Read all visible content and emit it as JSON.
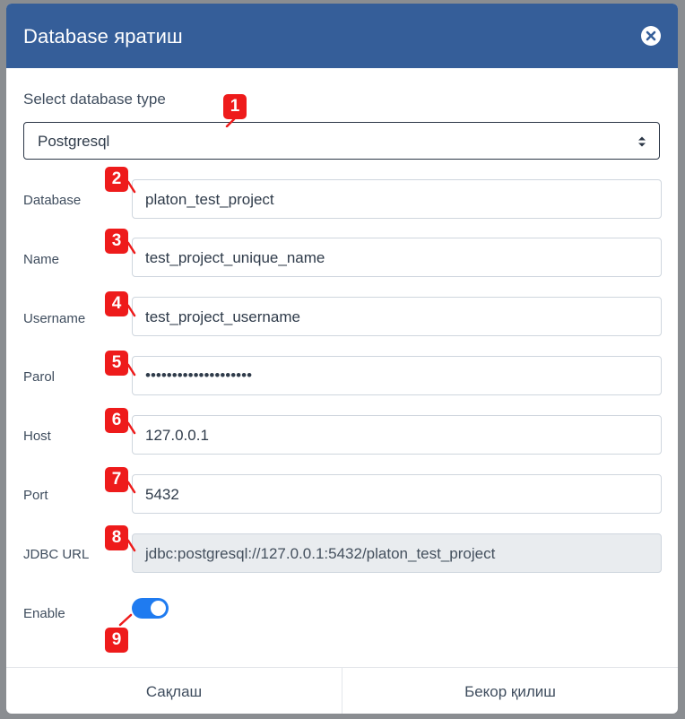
{
  "dialog": {
    "title": "Database яратиш"
  },
  "form": {
    "db_type_label": "Select database type",
    "db_type_value": "Postgresql",
    "fields": [
      {
        "label": "Database",
        "value": "platon_test_project",
        "badge": "2"
      },
      {
        "label": "Name",
        "value": "test_project_unique_name",
        "badge": "3"
      },
      {
        "label": "Username",
        "value": "test_project_username",
        "badge": "4"
      },
      {
        "label": "Parol",
        "value": "••••••••••••••••••••",
        "badge": "5"
      },
      {
        "label": "Host",
        "value": "127.0.0.1",
        "badge": "6"
      },
      {
        "label": "Port",
        "value": "5432",
        "badge": "7"
      },
      {
        "label": "JDBC URL",
        "value": "jdbc:postgresql://127.0.0.1:5432/platon_test_project",
        "badge": "8"
      }
    ],
    "enable_label": "Enable",
    "enable_on": true
  },
  "badges": {
    "select": "1",
    "toggle": "9"
  },
  "footer": {
    "save_label": "Сақлаш",
    "cancel_label": "Бекор қилиш"
  },
  "colors": {
    "header": "#355e99",
    "badge": "#ee1b1b",
    "toggle_on": "#1f7bf0"
  }
}
